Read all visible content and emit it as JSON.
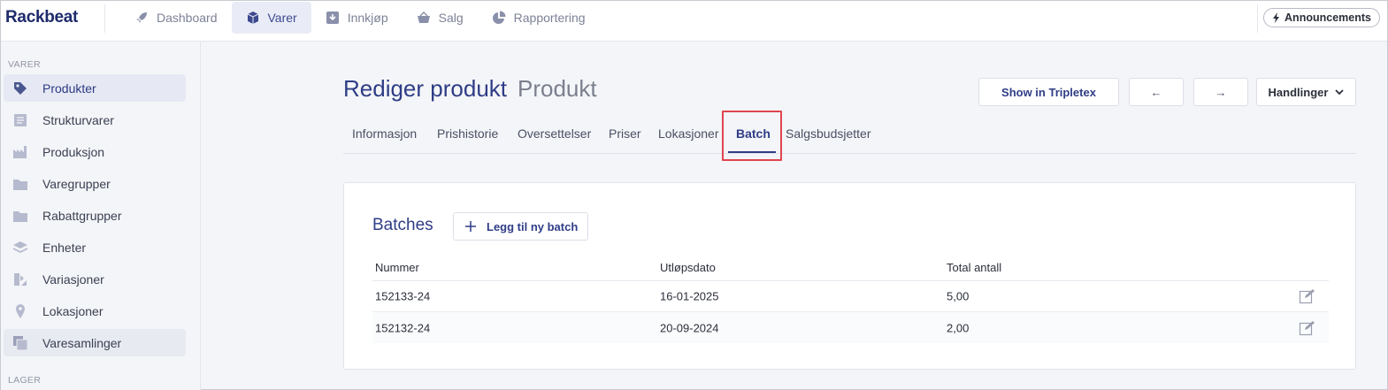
{
  "app": {
    "logo": "Rackbeat"
  },
  "nav": {
    "items": [
      {
        "label": "Dashboard",
        "icon": "rocket-icon",
        "active": false
      },
      {
        "label": "Varer",
        "icon": "box-icon",
        "active": true
      },
      {
        "label": "Innkjøp",
        "icon": "download-icon",
        "active": false
      },
      {
        "label": "Salg",
        "icon": "basket-icon",
        "active": false
      },
      {
        "label": "Rapportering",
        "icon": "pie-chart-icon",
        "active": false
      }
    ],
    "announcements_label": "Announcements"
  },
  "sidebar": {
    "section_varer": "VARER",
    "items": [
      {
        "label": "Produkter",
        "icon": "tag-icon"
      },
      {
        "label": "Strukturvarer",
        "icon": "list-doc-icon"
      },
      {
        "label": "Produksjon",
        "icon": "factory-icon"
      },
      {
        "label": "Varegrupper",
        "icon": "folder-icon"
      },
      {
        "label": "Rabattgrupper",
        "icon": "folder-icon"
      },
      {
        "label": "Enheter",
        "icon": "layers-icon"
      },
      {
        "label": "Variasjoner",
        "icon": "variants-icon"
      },
      {
        "label": "Lokasjoner",
        "icon": "pin-icon"
      },
      {
        "label": "Varesamlinger",
        "icon": "collection-icon"
      }
    ],
    "section_lager": "LAGER"
  },
  "page": {
    "title": "Rediger produkt",
    "subtitle": "Produkt",
    "show_in_tripletex": "Show in Tripletex",
    "prev_arrow": "←",
    "next_arrow": "→",
    "actions_label": "Handlinger"
  },
  "tabs": [
    "Informasjon",
    "Prishistorie",
    "Oversettelser",
    "Priser",
    "Lokasjoner",
    "Batch",
    "Salgsbudsjetter"
  ],
  "active_tab": "Batch",
  "batches": {
    "title": "Batches",
    "add_label": "Legg til ny batch",
    "columns": [
      "Nummer",
      "Utløpsdato",
      "Total antall"
    ],
    "rows": [
      {
        "nummer": "152133-24",
        "utlopsdato": "16-01-2025",
        "total": "5,00"
      },
      {
        "nummer": "152132-24",
        "utlopsdato": "20-09-2024",
        "total": "2,00"
      }
    ]
  },
  "colors": {
    "accent": "#2f3d86",
    "highlight": "#e0454f",
    "nav_active_bg": "#e9ecf6"
  }
}
